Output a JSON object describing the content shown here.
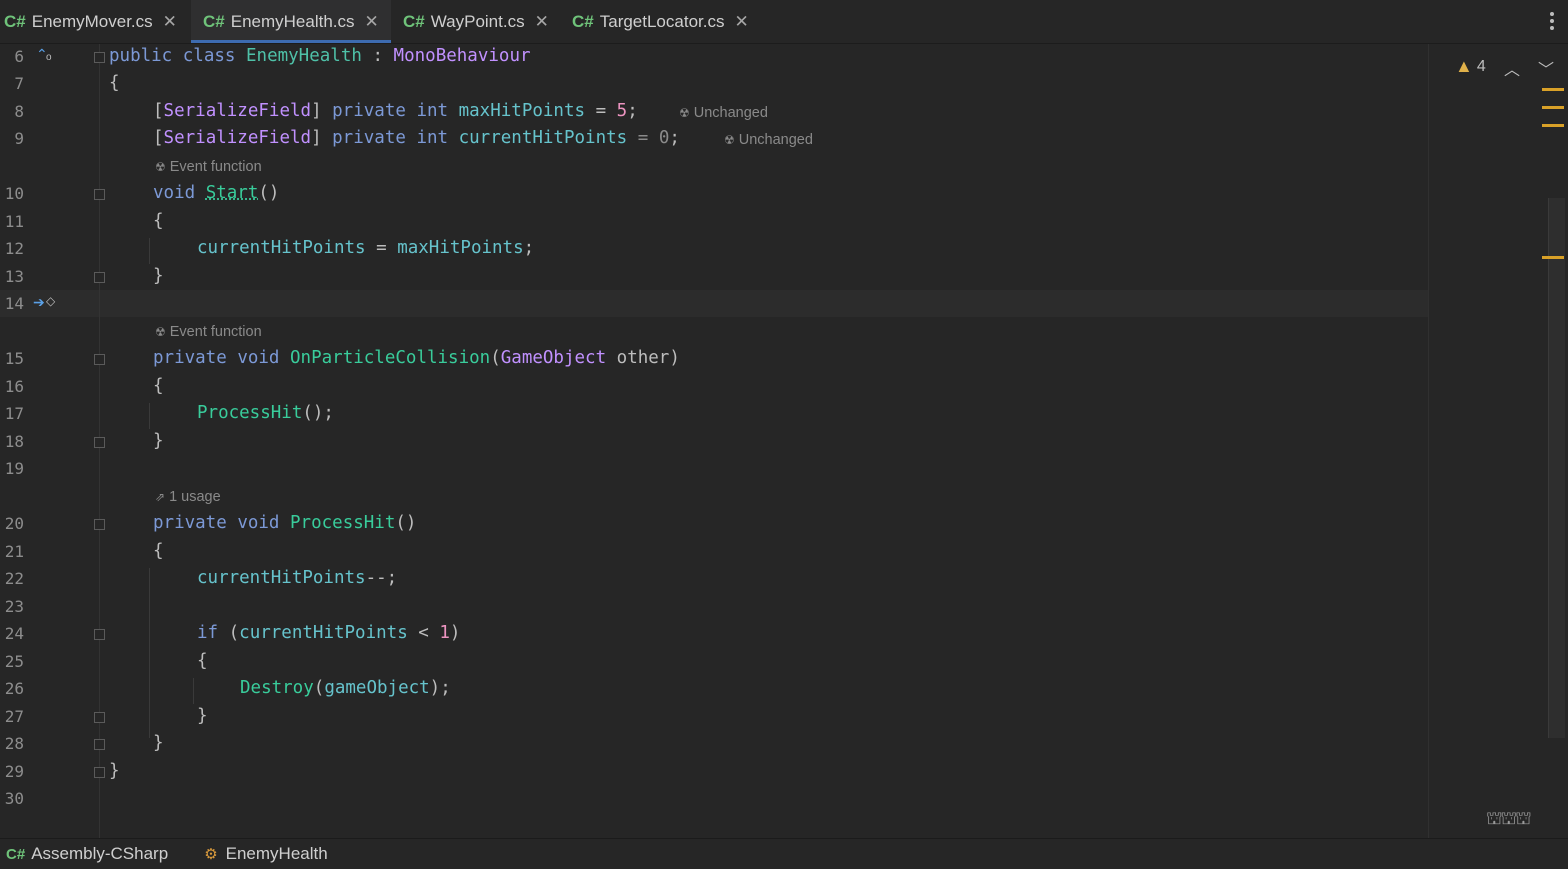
{
  "tabs": [
    {
      "icon": "C#",
      "label": "EnemyMover.cs",
      "active": false
    },
    {
      "icon": "C#",
      "label": "EnemyHealth.cs",
      "active": true
    },
    {
      "icon": "C#",
      "label": "WayPoint.cs",
      "active": false
    },
    {
      "icon": "C#",
      "label": "TargetLocator.cs",
      "active": false
    }
  ],
  "tab_close_glyph": "✕",
  "line_numbers": [
    "6",
    "7",
    "8",
    "9",
    "10",
    "11",
    "12",
    "13",
    "14",
    "15",
    "16",
    "17",
    "18",
    "19",
    "20",
    "21",
    "22",
    "23",
    "24",
    "25",
    "26",
    "27",
    "28",
    "29",
    "30"
  ],
  "hints": {
    "unchanged": "Unchanged",
    "event_function": "Event function",
    "usage": "1 usage"
  },
  "code": {
    "l6": [
      "public",
      "class",
      "EnemyHealth",
      ":",
      "MonoBehaviour"
    ],
    "brace_open": "{",
    "brace_close": "}",
    "serialize_field": "SerializeField",
    "private": "private",
    "int": "int",
    "void": "void",
    "if": "if",
    "max_hit_points": "maxHitPoints",
    "current_hit_points": "currentHitPoints",
    "val_5": "5",
    "val_0": "0",
    "val_1": "1",
    "start": "Start",
    "on_particle_collision": "OnParticleCollision",
    "game_object_type": "GameObject",
    "other": "other",
    "process_hit": "ProcessHit",
    "destroy": "Destroy",
    "game_object": "gameObject"
  },
  "warnings": {
    "count": "4"
  },
  "status": {
    "project": "Assembly-CSharp",
    "class": "EnemyHealth"
  },
  "colors": {
    "background": "#262626",
    "keyword": "#7c99d6",
    "type": "#c191ff",
    "method": "#39cc9b",
    "number": "#ed94c0",
    "warning": "#e0b14a",
    "tab_active_underline": "#3d6bb0"
  },
  "icons": [
    "csharp-icon",
    "close-icon",
    "more-vert-icon",
    "warning-icon",
    "chevron-up-icon",
    "chevron-down-icon",
    "unity-icon",
    "usage-icon",
    "override-icon",
    "run-arrow-icon",
    "class-icon",
    "ai-assistant-icon"
  ]
}
